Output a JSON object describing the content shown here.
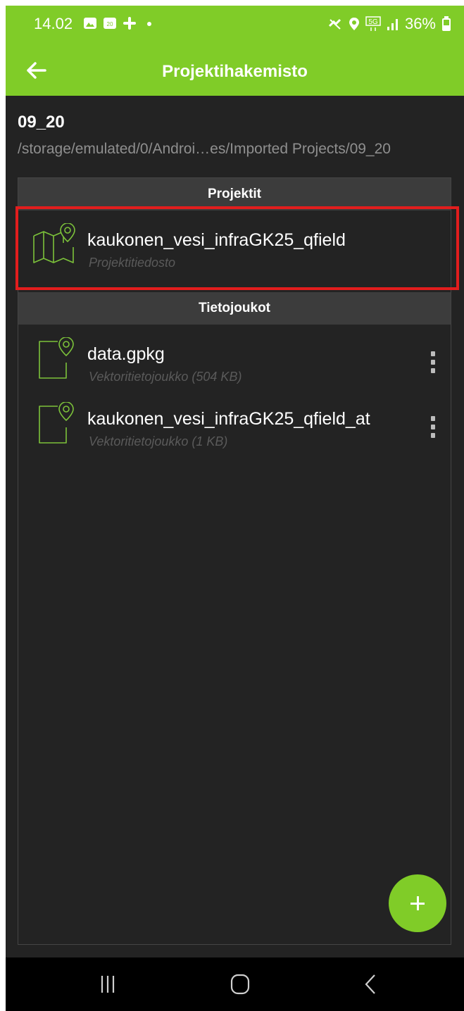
{
  "status_bar": {
    "time": "14.02",
    "battery": "36%",
    "network": "5G",
    "icons": [
      "gallery-icon",
      "calendar-icon",
      "slack-icon",
      "dot-icon",
      "mute-icon",
      "location-icon",
      "5g-icon",
      "signal-icon",
      "battery-icon"
    ],
    "calendar_day": "20"
  },
  "toolbar": {
    "title": "Projektihakemisto",
    "back_icon": "arrow-left-icon"
  },
  "folder": {
    "name": "09_20",
    "path": "/storage/emulated/0/Androi…es/Imported Projects/09_20"
  },
  "sections": {
    "projects_header": "Projektit",
    "datasets_header": "Tietojoukot"
  },
  "projects": [
    {
      "name": "kaukonen_vesi_infraGK25_qfield",
      "type": "Projektitiedosto",
      "icon": "map-pin-icon"
    }
  ],
  "datasets": [
    {
      "name": "data.gpkg",
      "type": "Vektoritietojoukko (504 KB)",
      "icon": "file-pin-icon"
    },
    {
      "name": "kaukonen_vesi_infraGK25_qfield_at",
      "type": "Vektoritietojoukko (1 KB)",
      "icon": "file-pin-icon"
    }
  ],
  "colors": {
    "accent": "#80cc28",
    "background": "#232323",
    "section": "#3c3c3c",
    "highlight": "#e21d1d"
  },
  "fab": {
    "icon": "plus-icon"
  },
  "navbar": {
    "icons": [
      "recents-icon",
      "home-icon",
      "back-nav-icon"
    ]
  }
}
